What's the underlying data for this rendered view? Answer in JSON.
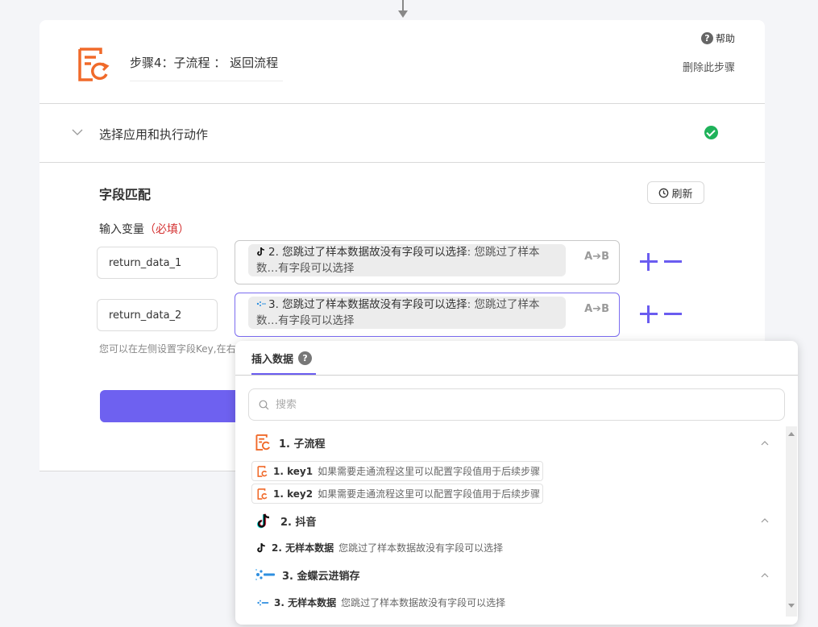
{
  "step": {
    "title": "步骤4：子流程 ： 返回流程",
    "help": "帮助",
    "delete": "删除此步骤"
  },
  "section": {
    "title": "选择应用和执行动作"
  },
  "mapping": {
    "title": "字段匹配",
    "refresh": "刷新",
    "input_vars_label": "输入变量",
    "required": "（必填）",
    "hint": "您可以在左侧设置字段Key,在右",
    "rows": [
      {
        "key": "return_data_1",
        "value_bold": "2. 您跳过了样本数据故没有字段可以选择",
        "value_rest": ": 您跳过了样本数…有字段可以选择",
        "value_icon": "tiktok-icon",
        "transform": "A➔B"
      },
      {
        "key": "return_data_2",
        "value_bold": "3. 您跳过了样本数据故没有字段可以选择",
        "value_rest": ": 您跳过了样本数…有字段可以选择",
        "value_icon": "kingdee-icon",
        "transform": "A➔B"
      }
    ]
  },
  "dropdown": {
    "tab": "插入数据",
    "search_placeholder": "搜索",
    "groups": [
      {
        "label": "1. 子流程",
        "icon": "subprocess-icon",
        "items": [
          {
            "name": "1. key1",
            "desc": "如果需要走通流程这里可以配置字段值用于后续步骤"
          },
          {
            "name": "1. key2",
            "desc": "如果需要走通流程这里可以配置字段值用于后续步骤"
          }
        ]
      },
      {
        "label": "2. 抖音",
        "icon": "tiktok-icon",
        "items": [
          {
            "name": "2. 无样本数据",
            "desc": "您跳过了样本数据故没有字段可以选择"
          }
        ]
      },
      {
        "label": "3. 金蝶云进销存",
        "icon": "kingdee-icon",
        "items": [
          {
            "name": "3. 无样本数据",
            "desc": "您跳过了样本数据故没有字段可以选择"
          }
        ]
      }
    ]
  },
  "colors": {
    "accent": "#6a5cf0",
    "success": "#1fb25a",
    "brand_orange": "#f06a2a",
    "required": "#d43030"
  }
}
